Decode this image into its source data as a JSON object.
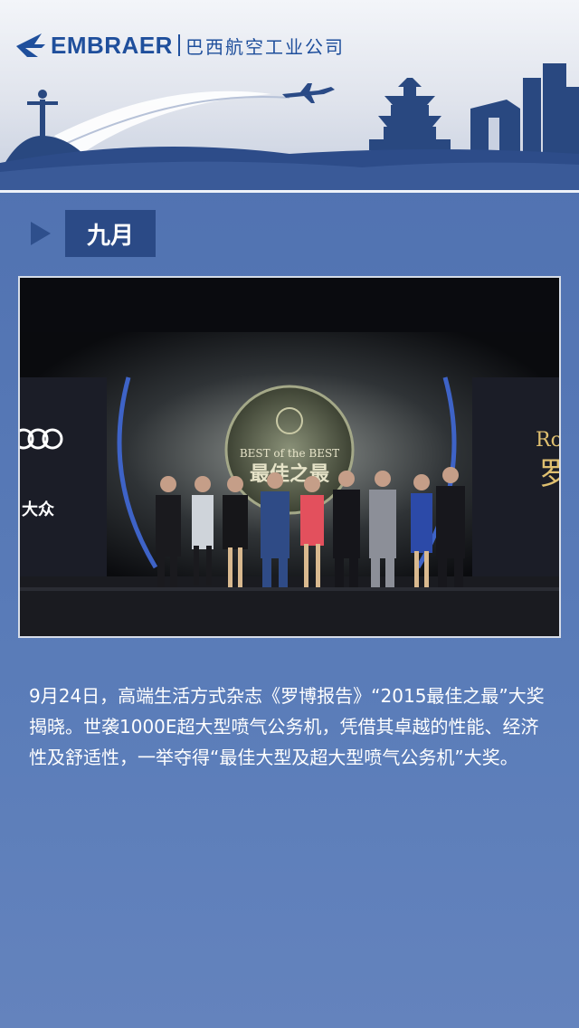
{
  "brand": {
    "name": "EMBRAER",
    "cn_name": "巴西航空工业公司"
  },
  "section": {
    "title": "九月"
  },
  "photo": {
    "backdrop_title_small": "BEST of the BEST",
    "backdrop_title_large": "最佳之最",
    "left_brand_text": "大众",
    "right_brand_text": "Ro",
    "right_brand_cn": "罗"
  },
  "article": {
    "paragraph": "9月24日，高端生活方式杂志《罗博报告》“2015最佳之最”大奖揭晓。世袭1000E超大型喷气公务机，凭借其卓越的性能、经济性及舒适性，一举夺得“最佳大型及超大型喷气公务机”大奖。"
  },
  "colors": {
    "accent": "#2b4a86",
    "brand_blue": "#1f4f9c",
    "background": "#5577b5"
  }
}
